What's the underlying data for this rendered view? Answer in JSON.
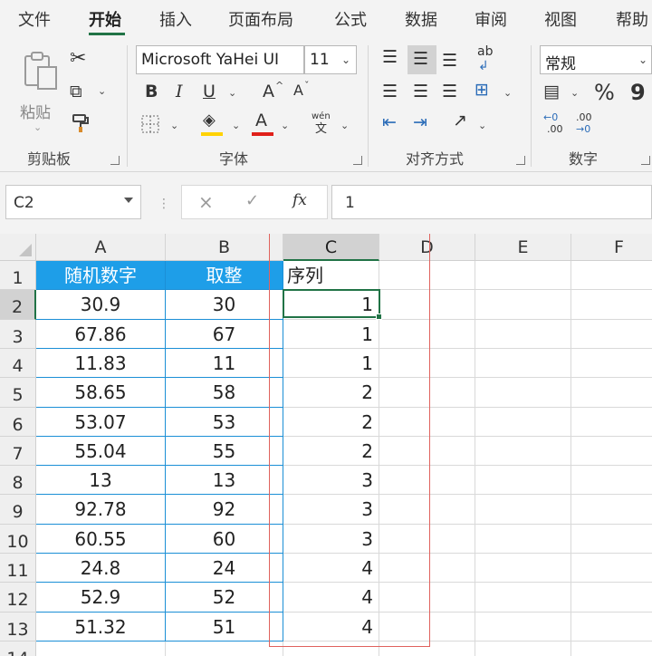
{
  "ribbon_tabs": [
    "文件",
    "开始",
    "插入",
    "页面布局",
    "公式",
    "数据",
    "审阅",
    "视图",
    "帮助"
  ],
  "active_tab": "开始",
  "clipboard": {
    "paste_label": "粘贴",
    "group_label": "剪贴板"
  },
  "font": {
    "font_name": "Microsoft YaHei UI",
    "font_size": "11",
    "bold_label": "B",
    "italic_label": "I",
    "underline_label": "U",
    "grow_label": "A",
    "shrink_label": "A",
    "font_color_label": "A",
    "phonetic_top": "wén",
    "phonetic_bottom": "文",
    "group_label": "字体",
    "fill_color": "#ffd200",
    "font_color": "#e0201a"
  },
  "alignment": {
    "wrap_label": "ab",
    "group_label": "对齐方式"
  },
  "number": {
    "format_value": "常规",
    "percent_label": "%",
    "comma_label": "9",
    "decimal_increase_top": "←0",
    "decimal_increase_bottom": ".00",
    "decimal_decrease_top": ".00",
    "decimal_decrease_bottom": "→0",
    "group_label": "数字"
  },
  "formula_bar": {
    "name_box": "C2",
    "cancel_symbol": "×",
    "enter_symbol": "✓",
    "function_symbol": "fx",
    "formula": "1"
  },
  "sheet": {
    "columns": [
      "A",
      "B",
      "C",
      "D",
      "E",
      "F"
    ],
    "selected_column": "C",
    "rows": [
      "1",
      "2",
      "3",
      "4",
      "5",
      "6",
      "7",
      "8",
      "9",
      "10",
      "11",
      "12",
      "13",
      "14"
    ],
    "selected_row": "2",
    "headers": {
      "A": "随机数字",
      "B": "取整",
      "C": "序列"
    },
    "data": [
      {
        "A": "30.9",
        "B": "30",
        "C": "1"
      },
      {
        "A": "67.86",
        "B": "67",
        "C": "1"
      },
      {
        "A": "11.83",
        "B": "11",
        "C": "1"
      },
      {
        "A": "58.65",
        "B": "58",
        "C": "2"
      },
      {
        "A": "53.07",
        "B": "53",
        "C": "2"
      },
      {
        "A": "55.04",
        "B": "55",
        "C": "2"
      },
      {
        "A": "13",
        "B": "13",
        "C": "3"
      },
      {
        "A": "92.78",
        "B": "92",
        "C": "3"
      },
      {
        "A": "60.55",
        "B": "60",
        "C": "3"
      },
      {
        "A": "24.8",
        "B": "24",
        "C": "4"
      },
      {
        "A": "52.9",
        "B": "52",
        "C": "4"
      },
      {
        "A": "51.32",
        "B": "51",
        "C": "4"
      }
    ],
    "active_cell": "C2",
    "header_fill": "#1e9ee8",
    "table_border": "#1b8fd6",
    "selection_color": "#217346",
    "highlight_box_color": "#e0625d"
  }
}
